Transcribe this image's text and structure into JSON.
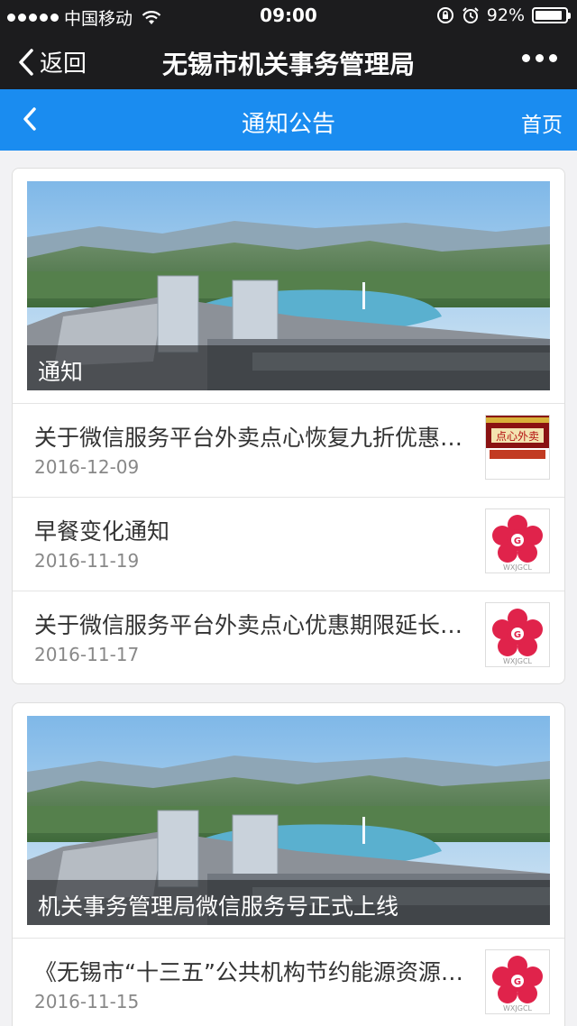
{
  "status_bar": {
    "carrier": "中国移动",
    "time": "09:00",
    "battery": "92%",
    "battery_level": 0.92
  },
  "wechat_nav": {
    "back_label": "返回",
    "title": "无锡市机关事务管理局"
  },
  "header": {
    "title": "通知公告",
    "home_label": "首页"
  },
  "sections": [
    {
      "banner_caption": "通知",
      "items": [
        {
          "title": "关于微信服务平台外卖点心恢复九折优惠的通知",
          "date": "2016-12-09",
          "thumb": "takeout-poster-thumbnail"
        },
        {
          "title": "早餐变化通知",
          "date": "2016-11-19",
          "thumb": "wxjgcl-logo-thumbnail"
        },
        {
          "title": "关于微信服务平台外卖点心优惠期限延长的通知",
          "date": "2016-11-17",
          "thumb": "wxjgcl-logo-thumbnail"
        }
      ]
    },
    {
      "banner_caption": "机关事务管理局微信服务号正式上线",
      "items": [
        {
          "title": "《无锡市“十三五”公共机构节约能源资源工作规划》",
          "date": "2016-11-15",
          "thumb": "wxjgcl-logo-thumbnail"
        }
      ]
    }
  ],
  "logo_text": "WXJGCL",
  "poster_text": "点心外卖",
  "colors": {
    "header_blue": "#1a8cf0",
    "top_bar": "#1c1c1e",
    "logo_red": "#e0234b"
  }
}
